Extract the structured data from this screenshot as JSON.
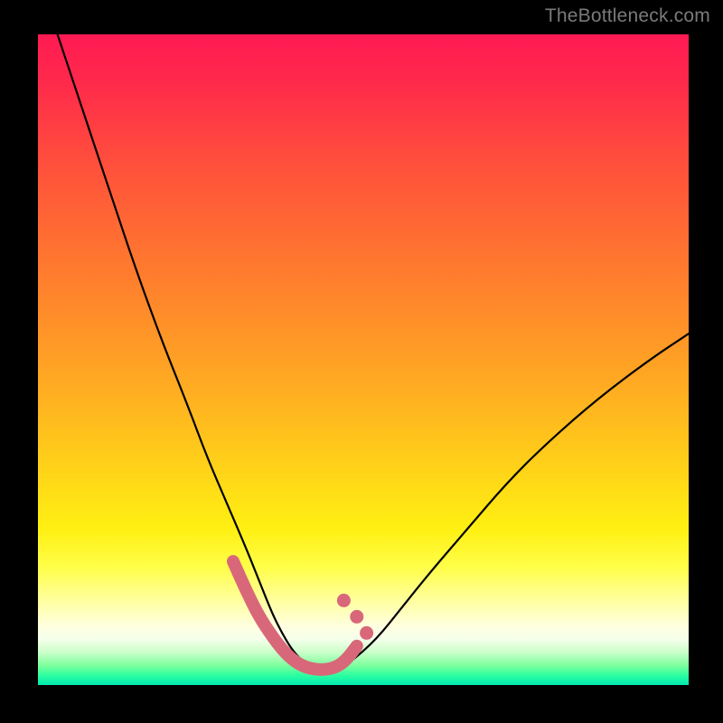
{
  "watermark": "TheBottleneck.com",
  "chart_data": {
    "type": "line",
    "title": "",
    "xlabel": "",
    "ylabel": "",
    "xlim": [
      0,
      100
    ],
    "ylim": [
      0,
      100
    ],
    "grid": false,
    "legend": false,
    "annotations": [],
    "series": [
      {
        "name": "black-curve",
        "color": "#000000",
        "x": [
          3,
          7,
          11,
          15,
          19,
          23,
          26,
          29,
          32,
          34,
          36,
          37.5,
          39,
          40.5,
          42,
          44,
          46,
          48,
          52,
          56,
          60,
          66,
          72,
          78,
          86,
          94,
          100
        ],
        "y": [
          100,
          88,
          76,
          64,
          53,
          43,
          35,
          28,
          21,
          16,
          11,
          8,
          5.5,
          3.8,
          2.7,
          2.1,
          2.3,
          3.5,
          7,
          12,
          17,
          24,
          31,
          37,
          44,
          50,
          54
        ]
      },
      {
        "name": "pink-highlight",
        "color": "#d9677a",
        "x": [
          30,
          32,
          34,
          36,
          37.5,
          39,
          40.5,
          42,
          44,
          46,
          47.5,
          49
        ],
        "y": [
          19,
          14.5,
          10.5,
          7.5,
          5.5,
          4,
          3,
          2.5,
          2.3,
          2.8,
          4,
          6
        ]
      },
      {
        "name": "pink-dot-cluster",
        "color": "#d9677a",
        "x": [
          47,
          49,
          50.5
        ],
        "y": [
          13,
          10.5,
          8
        ]
      }
    ],
    "gradient_stops": [
      {
        "pos": 0,
        "color": "#ff1a53"
      },
      {
        "pos": 18,
        "color": "#ff4a3e"
      },
      {
        "pos": 42,
        "color": "#ff8a2a"
      },
      {
        "pos": 66,
        "color": "#ffd019"
      },
      {
        "pos": 82,
        "color": "#fffe4a"
      },
      {
        "pos": 91,
        "color": "#ffffe0"
      },
      {
        "pos": 97,
        "color": "#7dff9d"
      },
      {
        "pos": 100,
        "color": "#00e8b0"
      }
    ]
  }
}
